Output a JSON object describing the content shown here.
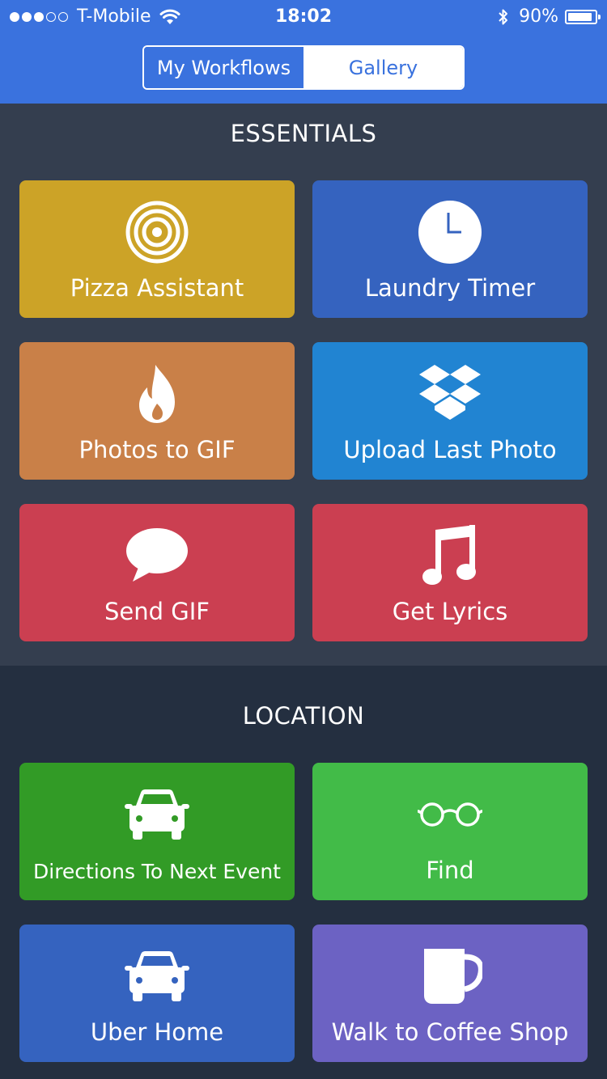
{
  "status_bar": {
    "signal_dots_filled": 3,
    "signal_dots_total": 5,
    "carrier": "T-Mobile",
    "time": "18:02",
    "battery": "90%",
    "battery_level": 0.9
  },
  "segmented": {
    "my_workflows": "My Workflows",
    "gallery": "Gallery",
    "selected": "Gallery"
  },
  "sections": [
    {
      "title": "ESSENTIALS",
      "tiles": [
        {
          "label": "Pizza Assistant",
          "icon": "target-icon",
          "color": "#cca327"
        },
        {
          "label": "Laundry Timer",
          "icon": "clock-icon",
          "color": "#3563bf"
        },
        {
          "label": "Photos to GIF",
          "icon": "flame-icon",
          "color": "#c98048"
        },
        {
          "label": "Upload Last Photo",
          "icon": "dropbox-icon",
          "color": "#2184d2"
        },
        {
          "label": "Send GIF",
          "icon": "speech-bubble-icon",
          "color": "#cb3f51"
        },
        {
          "label": "Get Lyrics",
          "icon": "music-note-icon",
          "color": "#cb3f51"
        }
      ]
    },
    {
      "title": "LOCATION",
      "tiles": [
        {
          "label": "Directions To Next Event",
          "icon": "car-icon",
          "color": "#329b26"
        },
        {
          "label": "Find",
          "icon": "glasses-icon",
          "color": "#42bb48"
        },
        {
          "label": "Uber Home",
          "icon": "car-icon",
          "color": "#3563bf"
        },
        {
          "label": "Walk to Coffee Shop",
          "icon": "coffee-mug-icon",
          "color": "#6c62c3"
        }
      ]
    }
  ]
}
